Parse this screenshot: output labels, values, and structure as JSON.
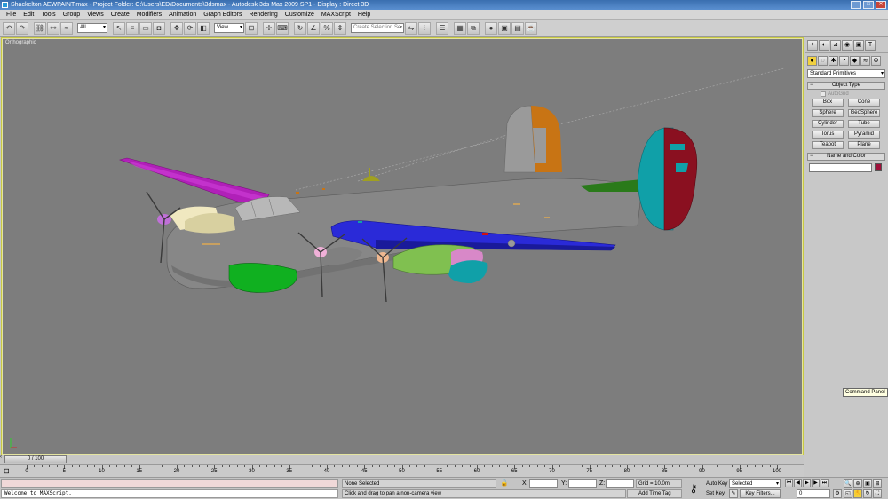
{
  "window": {
    "title": "Shackelton AEWPAINT.max  -  Project Folder: C:\\Users\\ED\\Documents\\3dsmax  -  Autodesk 3ds Max  2009 SP1  -  Display : Direct 3D",
    "controls": [
      "–",
      "□",
      "✕"
    ]
  },
  "menu": [
    "File",
    "Edit",
    "Tools",
    "Group",
    "Views",
    "Create",
    "Modifiers",
    "Animation",
    "Graph Editors",
    "Rendering",
    "Customize",
    "MAXScript",
    "Help"
  ],
  "toolbar": {
    "filter_value": "All",
    "refcoord_value": "View",
    "selection_set_placeholder": "Create Selection Se"
  },
  "viewport": {
    "label": "Orthographic"
  },
  "command_panel": {
    "category_value": "Standard Primitives",
    "object_type_title": "Object Type",
    "autogrid_label": "AutoGrid",
    "buttons": [
      "Box",
      "Cone",
      "Sphere",
      "GeoSphere",
      "Cylinder",
      "Tube",
      "Torus",
      "Pyramid",
      "Teapot",
      "Plane"
    ],
    "name_color_title": "Name and Color",
    "name_value": "",
    "swatch_color": "#a0103a"
  },
  "tooltip": "Command Panel",
  "time": {
    "slider_label": "0 / 100",
    "ticks": [
      "0",
      "5",
      "10",
      "15",
      "20",
      "25",
      "30",
      "35",
      "40",
      "45",
      "50",
      "55",
      "60",
      "65",
      "70",
      "75",
      "80",
      "85",
      "90",
      "95",
      "100"
    ]
  },
  "status": {
    "listener_text": "Welcome to MAXScript.",
    "selection": "None Selected",
    "prompt": "Click and drag to pan a non-camera view",
    "x_label": "X:",
    "y_label": "Y:",
    "z_label": "Z:",
    "x_value": "",
    "y_value": "",
    "z_value": "",
    "grid": "Grid = 10.0m",
    "add_time_tag": "Add Time Tag",
    "auto_key": "Auto Key",
    "set_key": "Set Key",
    "key_selected": "Selected",
    "key_filters": "Key Filters...",
    "frame": "0"
  }
}
